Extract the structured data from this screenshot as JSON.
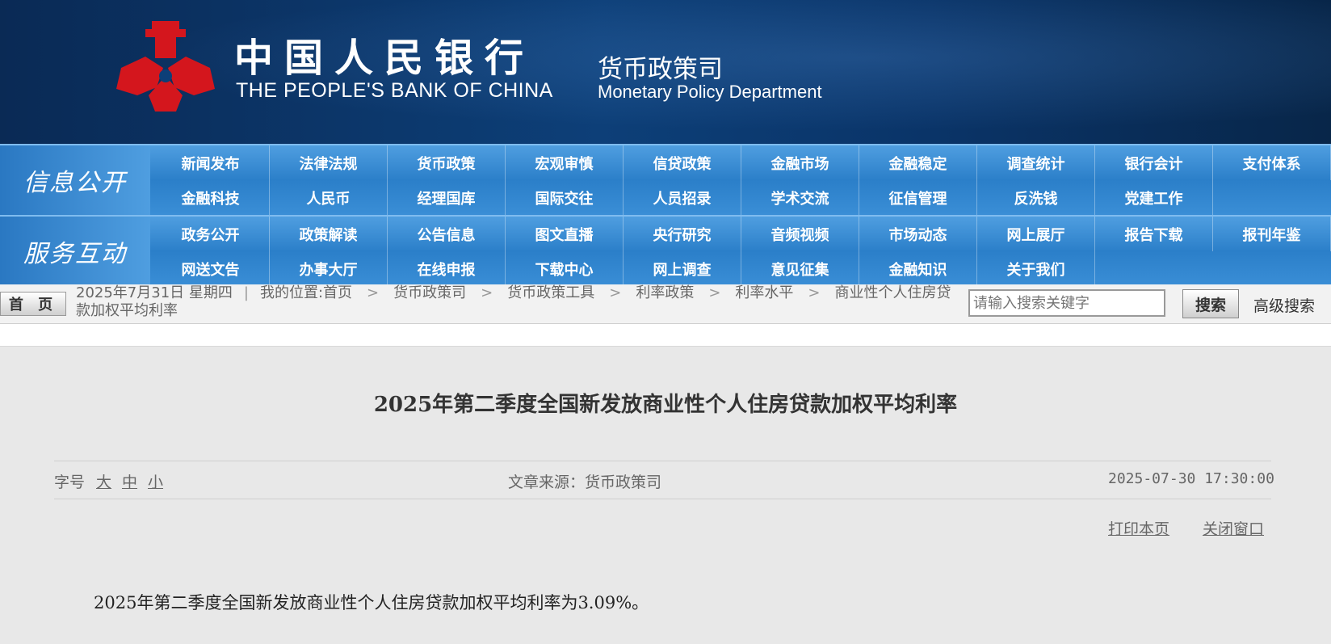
{
  "colors": {
    "banner_bg": "#0d3f78",
    "nav_bg": "#2b7fc9",
    "emblem": "#d4161d"
  },
  "header": {
    "bank_name_cn": "中国人民银行",
    "bank_name_en": "THE PEOPLE'S BANK OF CHINA",
    "dept_cn": "货币政策司",
    "dept_en": "Monetary Policy Department",
    "logo_icon": "pboc-emblem-icon"
  },
  "nav": {
    "info_title": "信息公开",
    "info_items": [
      "新闻发布",
      "法律法规",
      "货币政策",
      "宏观审慎",
      "信贷政策",
      "金融市场",
      "金融稳定",
      "调查统计",
      "银行会计",
      "支付体系",
      "金融科技",
      "人民币",
      "经理国库",
      "国际交往",
      "人员招录",
      "学术交流",
      "征信管理",
      "反洗钱",
      "党建工作",
      ""
    ],
    "service_title": "服务互动",
    "service_items": [
      "政务公开",
      "政策解读",
      "公告信息",
      "图文直播",
      "央行研究",
      "音频视频",
      "市场动态",
      "网上展厅",
      "报告下载",
      "报刊年鉴",
      "网送文告",
      "办事大厅",
      "在线申报",
      "下载中心",
      "网上调查",
      "意见征集",
      "金融知识",
      "关于我们",
      "",
      ""
    ]
  },
  "breadcrumb": {
    "home_label": "首 页",
    "date": "2025年7月31日  星期四",
    "location_prefix": "我的位置:",
    "items": [
      "首页",
      "货币政策司",
      "货币政策工具",
      "利率政策",
      "利率水平",
      "商业性个人住房贷款加权平均利率"
    ]
  },
  "search": {
    "placeholder": "请输入搜索关键字",
    "button_label": "搜索",
    "advanced_label": "高级搜索"
  },
  "article": {
    "title": "2025年第二季度全国新发放商业性个人住房贷款加权平均利率",
    "font_size_label": "字号",
    "font_sizes": [
      "大",
      "中",
      "小"
    ],
    "source": "文章来源：货币政策司",
    "date": "2025-07-30 17:30:00",
    "print_label": "打印本页",
    "close_label": "关闭窗口",
    "body": "2025年第二季度全国新发放商业性个人住房贷款加权平均利率为3.09%。"
  }
}
